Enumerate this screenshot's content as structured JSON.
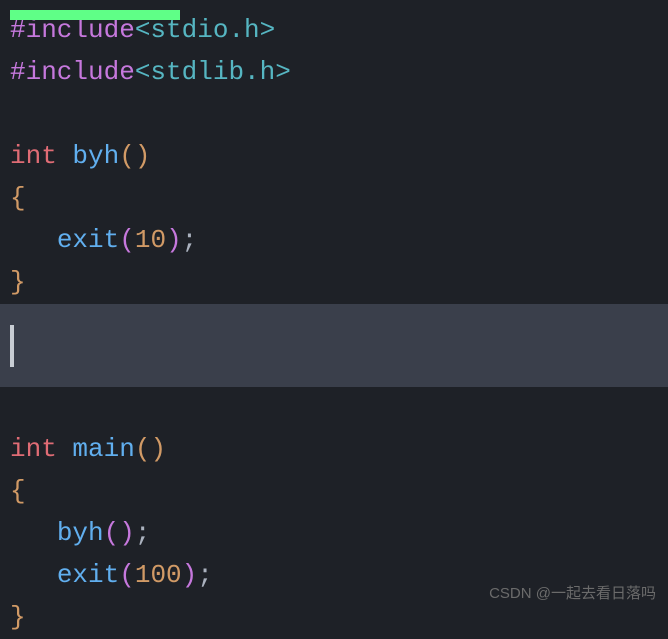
{
  "code": {
    "line1_preproc": "#include",
    "line1_header": "<stdio.h>",
    "line2_preproc": "#include",
    "line2_header": "<stdlib.h>",
    "func_kw": "int",
    "func1_name": "byh",
    "func2_name": "main",
    "brace_open": "{",
    "brace_close": "}",
    "exit_call": "exit",
    "exit_arg1": "10",
    "exit_arg2": "100",
    "byh_call": "byh",
    "paren_open": "(",
    "paren_close": ")",
    "semi": ";",
    "indent": "   "
  },
  "watermark": "CSDN @一起去看日落吗"
}
